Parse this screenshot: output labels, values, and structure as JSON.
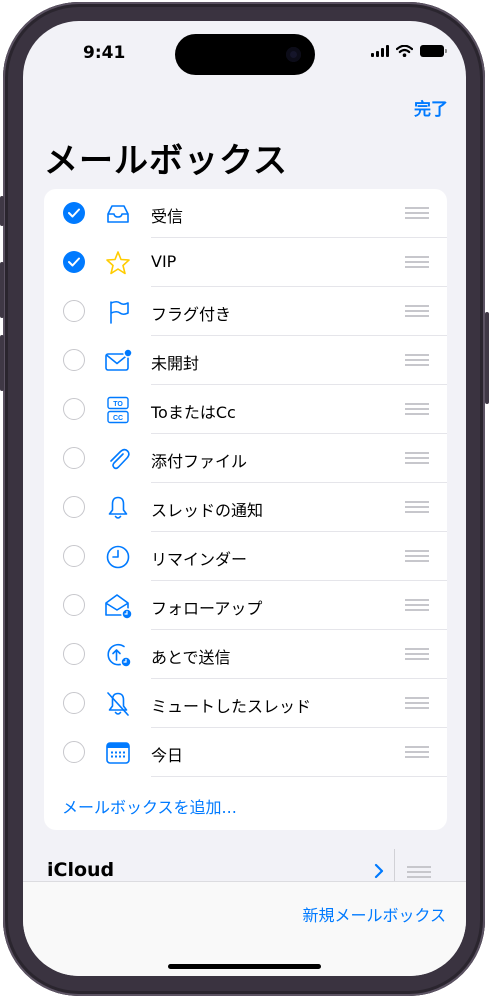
{
  "status_bar": {
    "time": "9:41"
  },
  "nav": {
    "done_label": "完了",
    "title": "メールボックス"
  },
  "mailboxes": [
    {
      "label": "受信",
      "checked": true,
      "icon": "inbox-tray-icon"
    },
    {
      "label": "VIP",
      "checked": true,
      "icon": "star-icon"
    },
    {
      "label": "フラグ付き",
      "checked": false,
      "icon": "flag-icon"
    },
    {
      "label": "未開封",
      "checked": false,
      "icon": "unread-envelope-icon"
    },
    {
      "label": "ToまたはCc",
      "checked": false,
      "icon": "to-cc-icon"
    },
    {
      "label": "添付ファイル",
      "checked": false,
      "icon": "paperclip-icon"
    },
    {
      "label": "スレッドの通知",
      "checked": false,
      "icon": "bell-icon"
    },
    {
      "label": "リマインダー",
      "checked": false,
      "icon": "clock-icon"
    },
    {
      "label": "フォローアップ",
      "checked": false,
      "icon": "follow-up-envelope-icon"
    },
    {
      "label": "あとで送信",
      "checked": false,
      "icon": "send-later-icon"
    },
    {
      "label": "ミュートしたスレッド",
      "checked": false,
      "icon": "muted-bell-icon"
    },
    {
      "label": "今日",
      "checked": false,
      "icon": "calendar-icon"
    }
  ],
  "to_cc_icon": {
    "top": "TO",
    "bottom": "CC"
  },
  "add_mailbox_label": "メールボックスを追加...",
  "icloud": {
    "label": "iCloud"
  },
  "toolbar": {
    "new_mailbox_label": "新規メールボックス"
  },
  "colors": {
    "accent": "#007aff",
    "background": "#f2f2f7",
    "separator": "#e5e5ea"
  }
}
